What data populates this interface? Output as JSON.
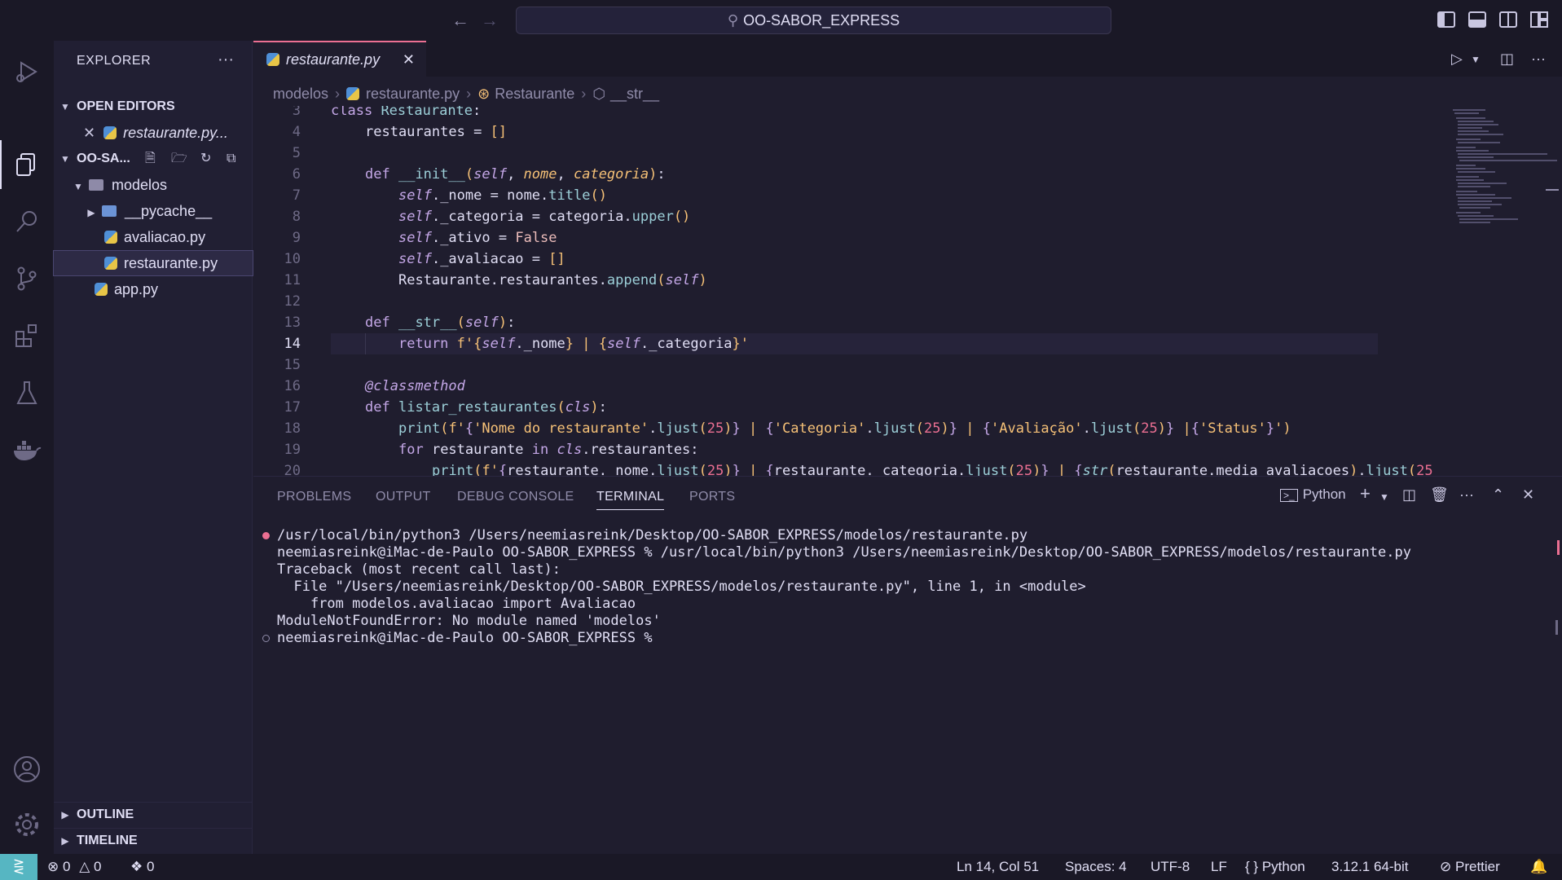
{
  "titlebar": {
    "search_text": "OO-SABOR_EXPRESS"
  },
  "sidebar": {
    "title": "EXPLORER",
    "open_editors_label": "OPEN EDITORS",
    "open_editor_file": "restaurante.py...",
    "project_label": "OO-SA...",
    "tree": {
      "modelos": "modelos",
      "pycache": "__pycache__",
      "avaliacao": "avaliacao.py",
      "restaurante": "restaurante.py",
      "app": "app.py"
    },
    "outline_label": "OUTLINE",
    "timeline_label": "TIMELINE"
  },
  "editor": {
    "tab_label": "restaurante.py",
    "breadcrumb": [
      "modelos",
      "restaurante.py",
      "Restaurante",
      "__str__"
    ],
    "current_line": 14
  },
  "panel": {
    "tabs": [
      "PROBLEMS",
      "OUTPUT",
      "DEBUG CONSOLE",
      "TERMINAL",
      "PORTS"
    ],
    "active_tab": "TERMINAL",
    "shell_label": "Python",
    "terminal_lines": [
      "/usr/local/bin/python3 /Users/neemiasreink/Desktop/OO-SABOR_EXPRESS/modelos/restaurante.py",
      "neemiasreink@iMac-de-Paulo OO-SABOR_EXPRESS % /usr/local/bin/python3 /Users/neemiasreink/Desktop/OO-SABOR_EXPRESS/modelos/restaurante.py",
      "Traceback (most recent call last):",
      "  File \"/Users/neemiasreink/Desktop/OO-SABOR_EXPRESS/modelos/restaurante.py\", line 1, in <module>",
      "    from modelos.avaliacao import Avaliacao",
      "ModuleNotFoundError: No module named 'modelos'",
      "neemiasreink@iMac-de-Paulo OO-SABOR_EXPRESS %"
    ]
  },
  "statusbar": {
    "errors": "0",
    "warnings": "0",
    "ports": "0",
    "position": "Ln 14, Col 51",
    "spaces": "Spaces: 4",
    "encoding": "UTF-8",
    "eol": "LF",
    "language": "Python",
    "interpreter": "3.12.1 64-bit",
    "formatter": "Prettier"
  },
  "colors": {
    "background": "#1f1d2e",
    "accent_pink": "#eb6f92",
    "accent_teal": "#56b6c2",
    "error_red": "#eb6f92"
  }
}
